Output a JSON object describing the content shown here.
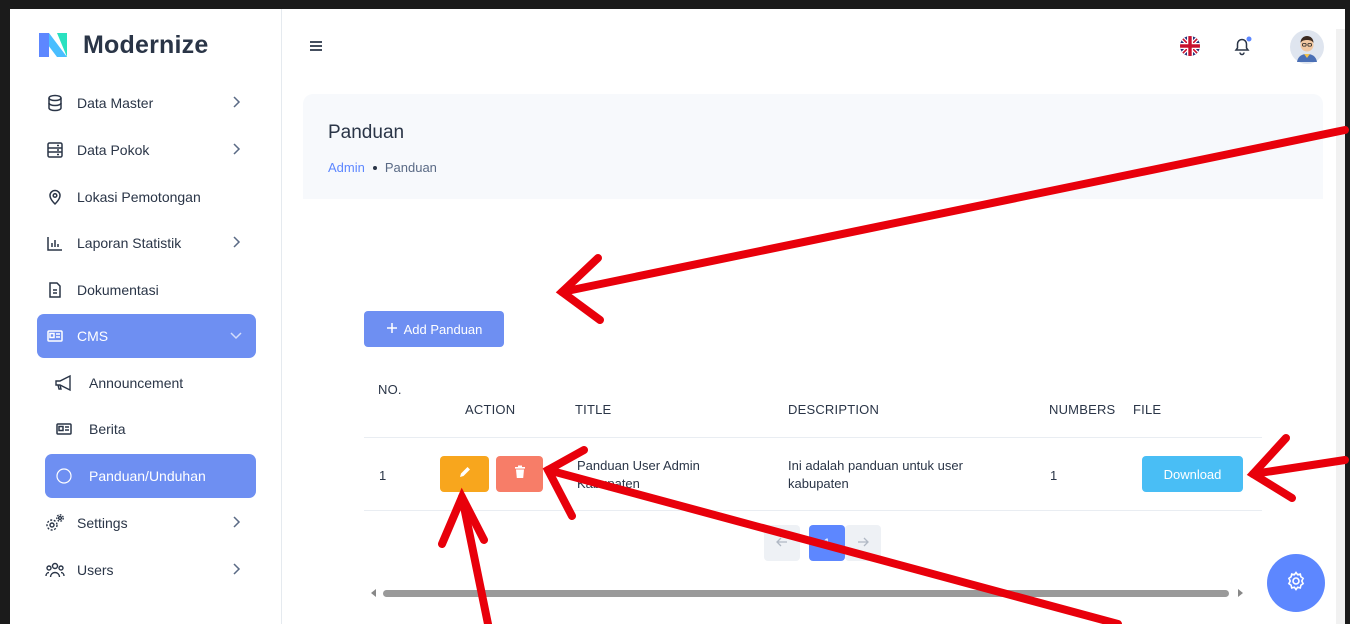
{
  "app": {
    "name": "Modernize"
  },
  "sidebar": {
    "items": [
      {
        "label": "Data Master",
        "icon": "database-icon",
        "has_children": true
      },
      {
        "label": "Data Pokok",
        "icon": "server-icon",
        "has_children": true
      },
      {
        "label": "Lokasi Pemotongan",
        "icon": "map-pin-icon",
        "has_children": false
      },
      {
        "label": "Laporan Statistik",
        "icon": "bar-chart-icon",
        "has_children": true
      },
      {
        "label": "Dokumentasi",
        "icon": "document-icon",
        "has_children": false
      },
      {
        "label": "CMS",
        "icon": "news-icon",
        "has_children": true,
        "expanded": true,
        "active": true
      }
    ],
    "cms_children": [
      {
        "label": "Announcement",
        "icon": "megaphone-icon"
      },
      {
        "label": "Berita",
        "icon": "news-icon"
      },
      {
        "label": "Panduan/Unduhan",
        "icon": "circle-icon",
        "active": true
      }
    ],
    "bottom_items": [
      {
        "label": "Settings",
        "icon": "settings-icon",
        "has_children": true
      },
      {
        "label": "Users",
        "icon": "users-icon",
        "has_children": true
      }
    ]
  },
  "topbar": {
    "icons": [
      "menu-icon",
      "uk-flag-icon",
      "bell-icon",
      "avatar"
    ]
  },
  "page": {
    "title": "Panduan",
    "breadcrumb": [
      "Admin",
      "Panduan"
    ]
  },
  "toolbar": {
    "add_label": "Add Panduan"
  },
  "table": {
    "headers": {
      "no": "NO.",
      "action": "ACTION",
      "title": "TITLE",
      "description": "DESCRIPTION",
      "numbers": "NUMBERS",
      "file": "FILE"
    },
    "rows": [
      {
        "no": "1",
        "title_line1": "Panduan User Admin",
        "title_line2": "Kabupaten",
        "desc_line1": "Ini adalah panduan untuk user",
        "desc_line2": "kabupaten",
        "numbers": "1",
        "file_label": "Download"
      }
    ]
  },
  "pagination": {
    "current": "1"
  },
  "colors": {
    "primary": "#5d87ff",
    "edit": "#f8a61d",
    "delete": "#f77d68",
    "download": "#49bef5",
    "annotation": "#e8000b"
  }
}
